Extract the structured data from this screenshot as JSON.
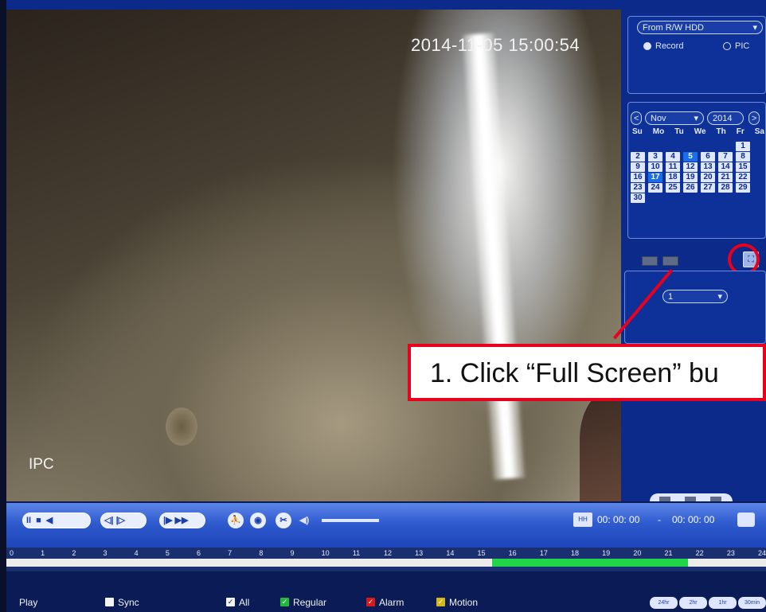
{
  "video": {
    "timestamp": "2014-11-05 15:00:54",
    "channel_label": "IPC"
  },
  "source_panel": {
    "source_select": "From R/W HDD",
    "record_label": "Record",
    "pic_label": "PIC",
    "selected_mode": "Record"
  },
  "calendar": {
    "prev_label": "<",
    "next_label": ">",
    "month": "Nov",
    "year": "2014",
    "weekdays": [
      "Su",
      "Mo",
      "Tu",
      "We",
      "Th",
      "Fr",
      "Sa"
    ],
    "days": [
      "",
      "",
      "",
      "",
      "",
      "",
      "1",
      "2",
      "3",
      "4",
      "5",
      "6",
      "7",
      "8",
      "9",
      "10",
      "11",
      "12",
      "13",
      "14",
      "15",
      "16",
      "17",
      "18",
      "19",
      "20",
      "21",
      "22",
      "23",
      "24",
      "25",
      "26",
      "27",
      "28",
      "29",
      "30"
    ],
    "selected_day": "5",
    "highlight_day": "17"
  },
  "channel_select": {
    "value": "1"
  },
  "callout": {
    "text": "1. Click  “Full Screen” bu"
  },
  "toolbar": {
    "pause": "II",
    "stop": "■",
    "reverse": "◀",
    "slow": "◁|  |▷",
    "fast": "|▶  ▶▶",
    "smart_search": "⛹",
    "snapshot": "◉",
    "clip": "✂",
    "volume": "◀)",
    "time_start": "00: 00: 00",
    "time_sep": "-",
    "time_end": "00: 00: 00"
  },
  "timeline": {
    "hours": [
      "0",
      "1",
      "2",
      "3",
      "4",
      "5",
      "6",
      "7",
      "8",
      "9",
      "10",
      "11",
      "12",
      "13",
      "14",
      "15",
      "16",
      "17",
      "18",
      "19",
      "20",
      "21",
      "22",
      "23",
      "24"
    ]
  },
  "footer": {
    "play_label": "Play",
    "sync_label": "Sync",
    "all_label": "All",
    "regular_label": "Regular",
    "alarm_label": "Alarm",
    "motion_label": "Motion",
    "zoom_options": [
      "24hr",
      "2hr",
      "1hr",
      "30min"
    ]
  },
  "colors": {
    "panel_blue": "#0b2a8a",
    "callout_red": "#e8001c",
    "record_green": "#22d44a",
    "regular_check": "#22b83a",
    "alarm_check": "#d41a1a",
    "motion_check": "#d4b81a"
  }
}
